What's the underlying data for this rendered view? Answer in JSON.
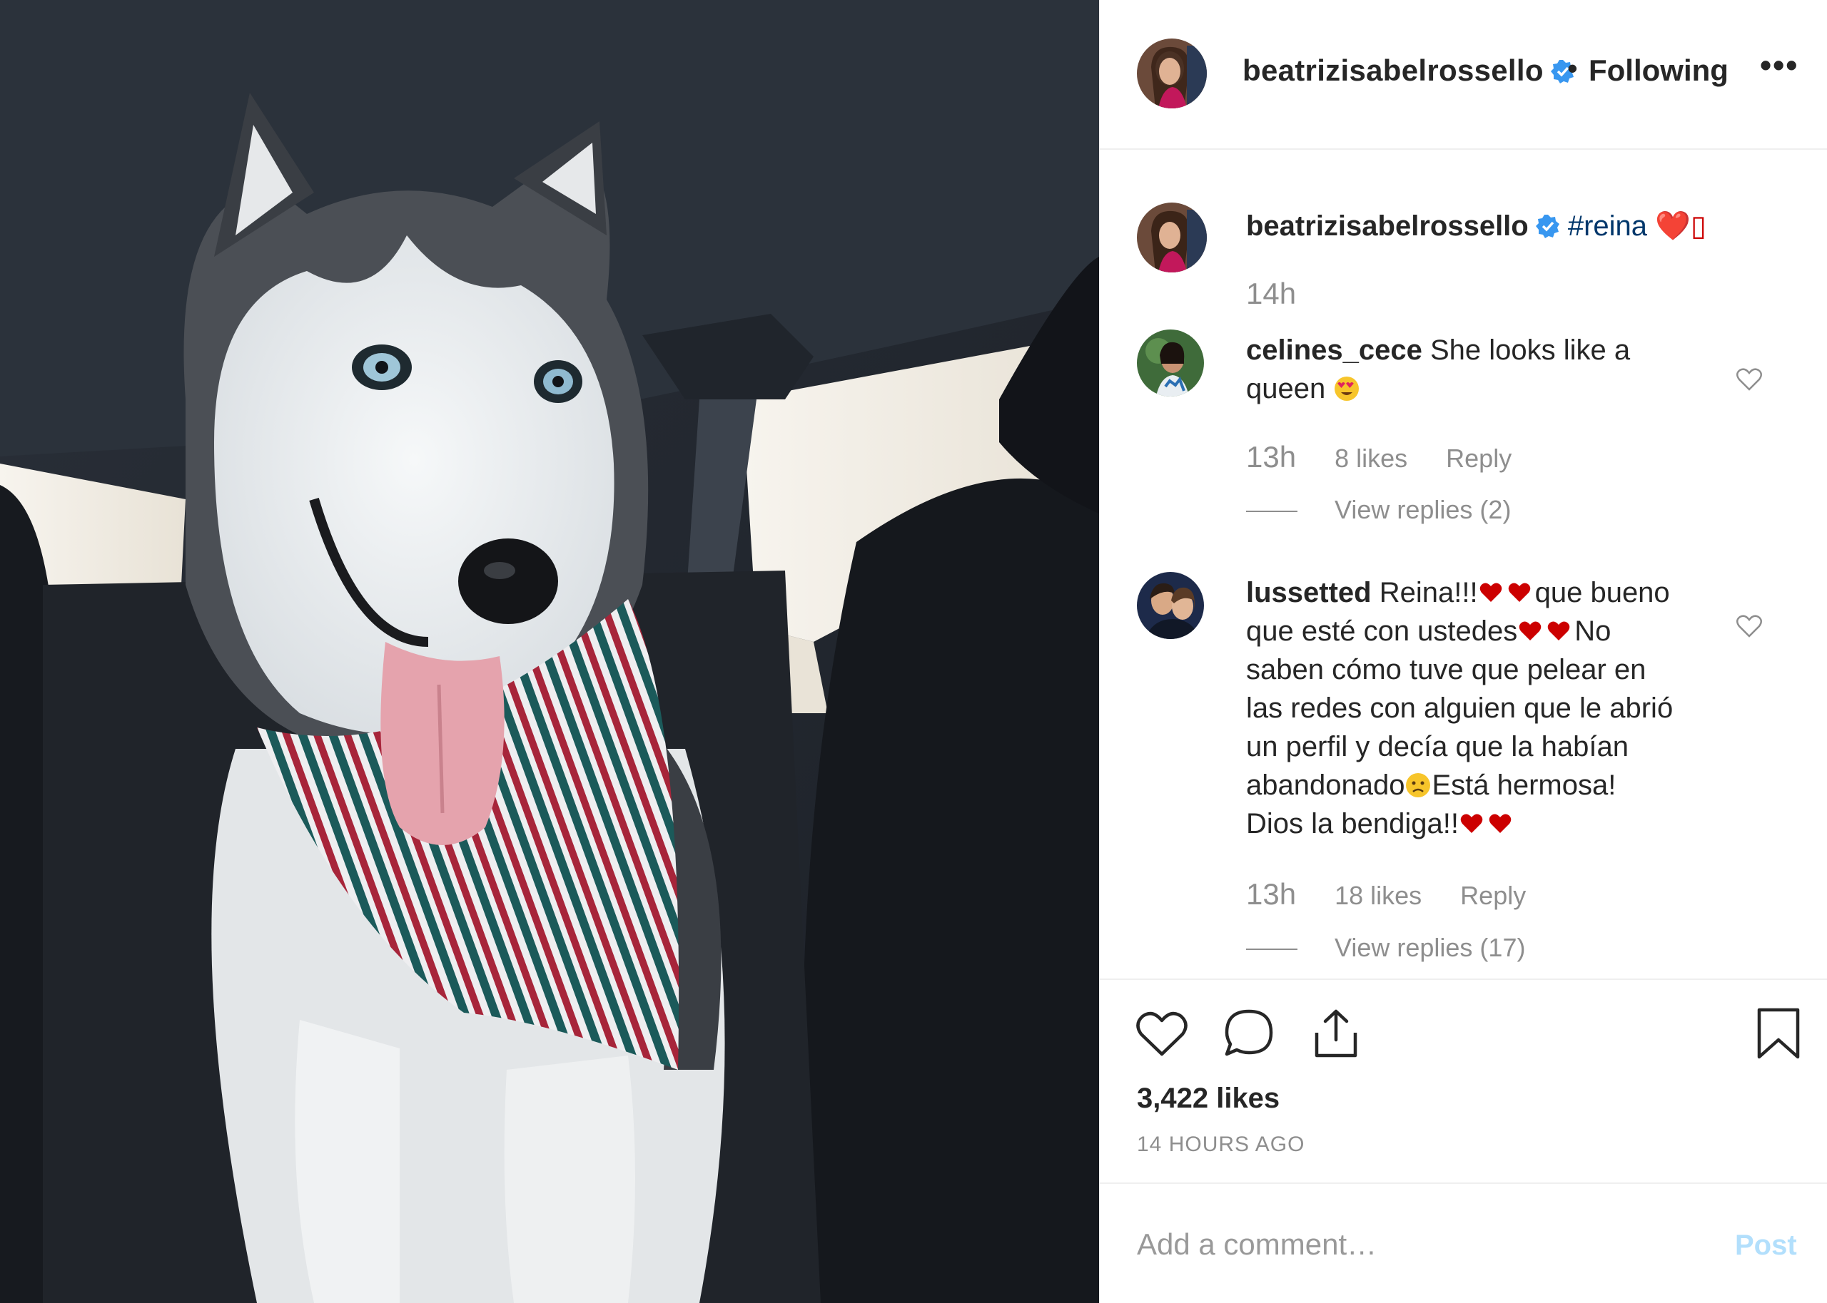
{
  "photo": {
    "description_icon": "husky-dog-photo"
  },
  "header": {
    "username": "beatrizisabelrossello",
    "separator": "•",
    "follow_label": "Following",
    "more_label": "•••"
  },
  "caption": {
    "username": "beatrizisabelrossello",
    "hashtag": "#reina",
    "trailing": "❤️▯",
    "time": "14h"
  },
  "comments": [
    {
      "username": "celines_cece",
      "text_line1": "She looks like a",
      "text_line2": "queen",
      "time": "13h",
      "likes": "8 likes",
      "reply_label": "Reply",
      "view_replies": "View replies (2)"
    },
    {
      "username": "lussetted",
      "seg1": "Reina!!!",
      "seg2": "que bueno",
      "line2a": "que esté con ustedes",
      "line2b": "No",
      "line3": "saben cómo tuve que pelear en",
      "line4": "las redes con alguien que le abrió",
      "line5": "un perfil y decía que la habían",
      "line6a": "abandonado",
      "line6b": "Está hermosa!",
      "line7": "Dios la bendiga!!",
      "time": "13h",
      "likes": "18 likes",
      "reply_label": "Reply",
      "view_replies": "View replies (17)"
    }
  ],
  "actions": {
    "likes": "3,422 likes",
    "ago": "14 HOURS AGO"
  },
  "add_comment": {
    "placeholder": "Add a comment…",
    "post_label": "Post"
  },
  "colors": {
    "verified": "#3897f0",
    "heart": "#cc0000",
    "link": "#00376b",
    "meta": "#8e8e8e",
    "post_disabled": "#b2dffc"
  }
}
